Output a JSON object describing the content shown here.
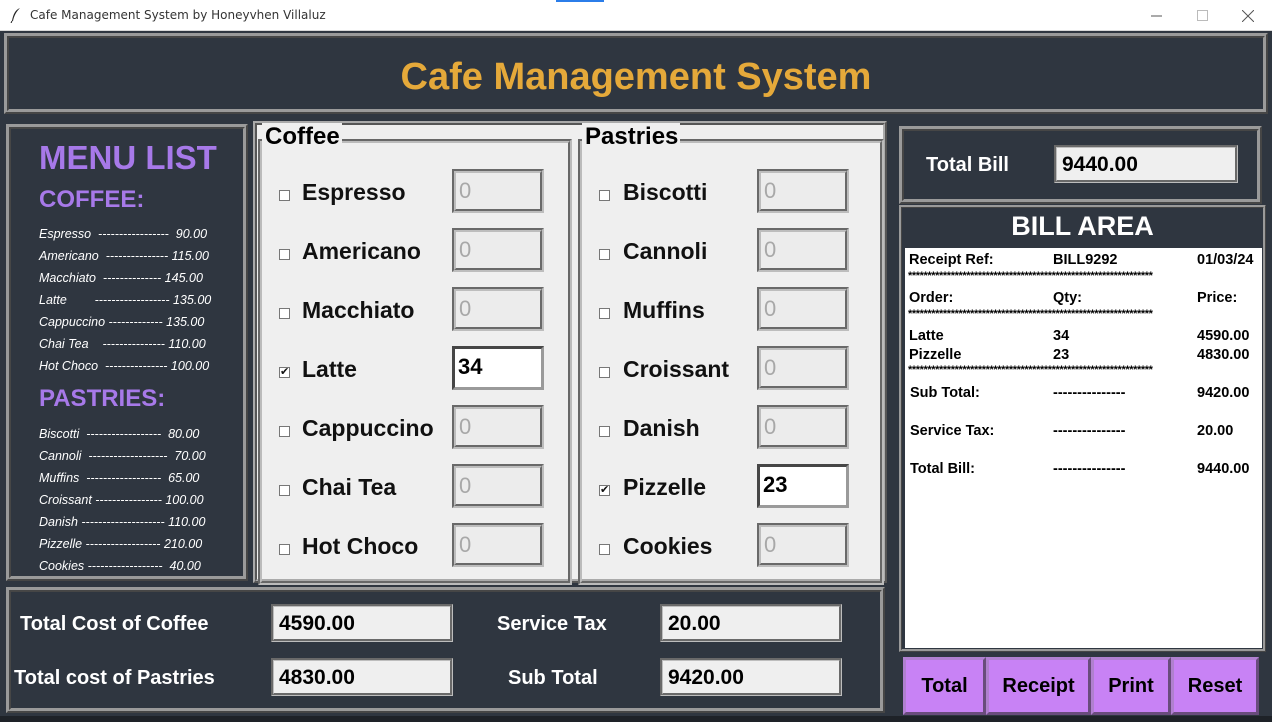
{
  "window": {
    "title": "Cafe Management System by Honeyvhen Villaluz"
  },
  "header": {
    "title": "Cafe Management System"
  },
  "menu": {
    "title": "MENU LIST",
    "coffee_heading": "COFFEE:",
    "coffee_items": [
      "Espresso  -----------------  90.00",
      "Americano  --------------- 115.00",
      "Macchiato  -------------- 145.00",
      "Latte        ------------------ 135.00",
      "Cappuccino ------------- 135.00",
      "Chai Tea    --------------- 110.00",
      "Hot Choco  --------------- 100.00"
    ],
    "pastries_heading": "PASTRIES:",
    "pastry_items": [
      "Biscotti  ------------------  80.00",
      "Cannoli  -------------------  70.00",
      "Muffins  ------------------  65.00",
      "Croissant ---------------- 100.00",
      "Danish -------------------- 110.00",
      "Pizzelle ------------------ 210.00",
      "Cookies ------------------  40.00"
    ]
  },
  "coffee": {
    "title": "Coffee",
    "items": [
      {
        "label": "Espresso",
        "qty": "0",
        "checked": false
      },
      {
        "label": "Americano",
        "qty": "0",
        "checked": false
      },
      {
        "label": "Macchiato",
        "qty": "0",
        "checked": false
      },
      {
        "label": "Latte",
        "qty": "34",
        "checked": true
      },
      {
        "label": "Cappuccino",
        "qty": "0",
        "checked": false
      },
      {
        "label": "Chai Tea",
        "qty": "0",
        "checked": false
      },
      {
        "label": "Hot Choco",
        "qty": "0",
        "checked": false
      }
    ]
  },
  "pastries": {
    "title": "Pastries",
    "items": [
      {
        "label": "Biscotti",
        "qty": "0",
        "checked": false
      },
      {
        "label": "Cannoli",
        "qty": "0",
        "checked": false
      },
      {
        "label": "Muffins",
        "qty": "0",
        "checked": false
      },
      {
        "label": "Croissant",
        "qty": "0",
        "checked": false
      },
      {
        "label": "Danish",
        "qty": "0",
        "checked": false
      },
      {
        "label": "Pizzelle",
        "qty": "23",
        "checked": true
      },
      {
        "label": "Cookies",
        "qty": "0",
        "checked": false
      }
    ]
  },
  "totals": {
    "coffee_label": "Total Cost of Coffee",
    "coffee_value": "4590.00",
    "pastries_label": "Total cost of Pastries",
    "pastries_value": "4830.00",
    "tax_label": "Service Tax",
    "tax_value": "20.00",
    "subtotal_label": "Sub Total",
    "subtotal_value": "9420.00"
  },
  "total_bill": {
    "label": "Total Bill",
    "value": "9440.00"
  },
  "bill": {
    "heading": "BILL AREA",
    "receipt_label": "Receipt Ref:",
    "receipt_ref": "BILL9292",
    "date": "01/03/24",
    "stars": "***************************************************************",
    "col_order": "Order:",
    "col_qty": "Qty:",
    "col_price": "Price:",
    "lines": [
      {
        "item": "Latte",
        "qty": "34",
        "price": "4590.00"
      },
      {
        "item": "Pizzelle",
        "qty": "23",
        "price": "4830.00"
      }
    ],
    "dashes": "---------------",
    "subtotal_label": "Sub Total:",
    "subtotal_value": "9420.00",
    "tax_label": "Service Tax:",
    "tax_value": "20.00",
    "total_label": "Total Bill:",
    "total_value": "9440.00"
  },
  "buttons": {
    "total": "Total",
    "receipt": "Receipt",
    "print": "Print",
    "reset": "Reset"
  },
  "colors": {
    "background": "#2f3640",
    "title": "#e5a93a",
    "menu_accent": "#a779e9",
    "button": "#c882f5"
  }
}
